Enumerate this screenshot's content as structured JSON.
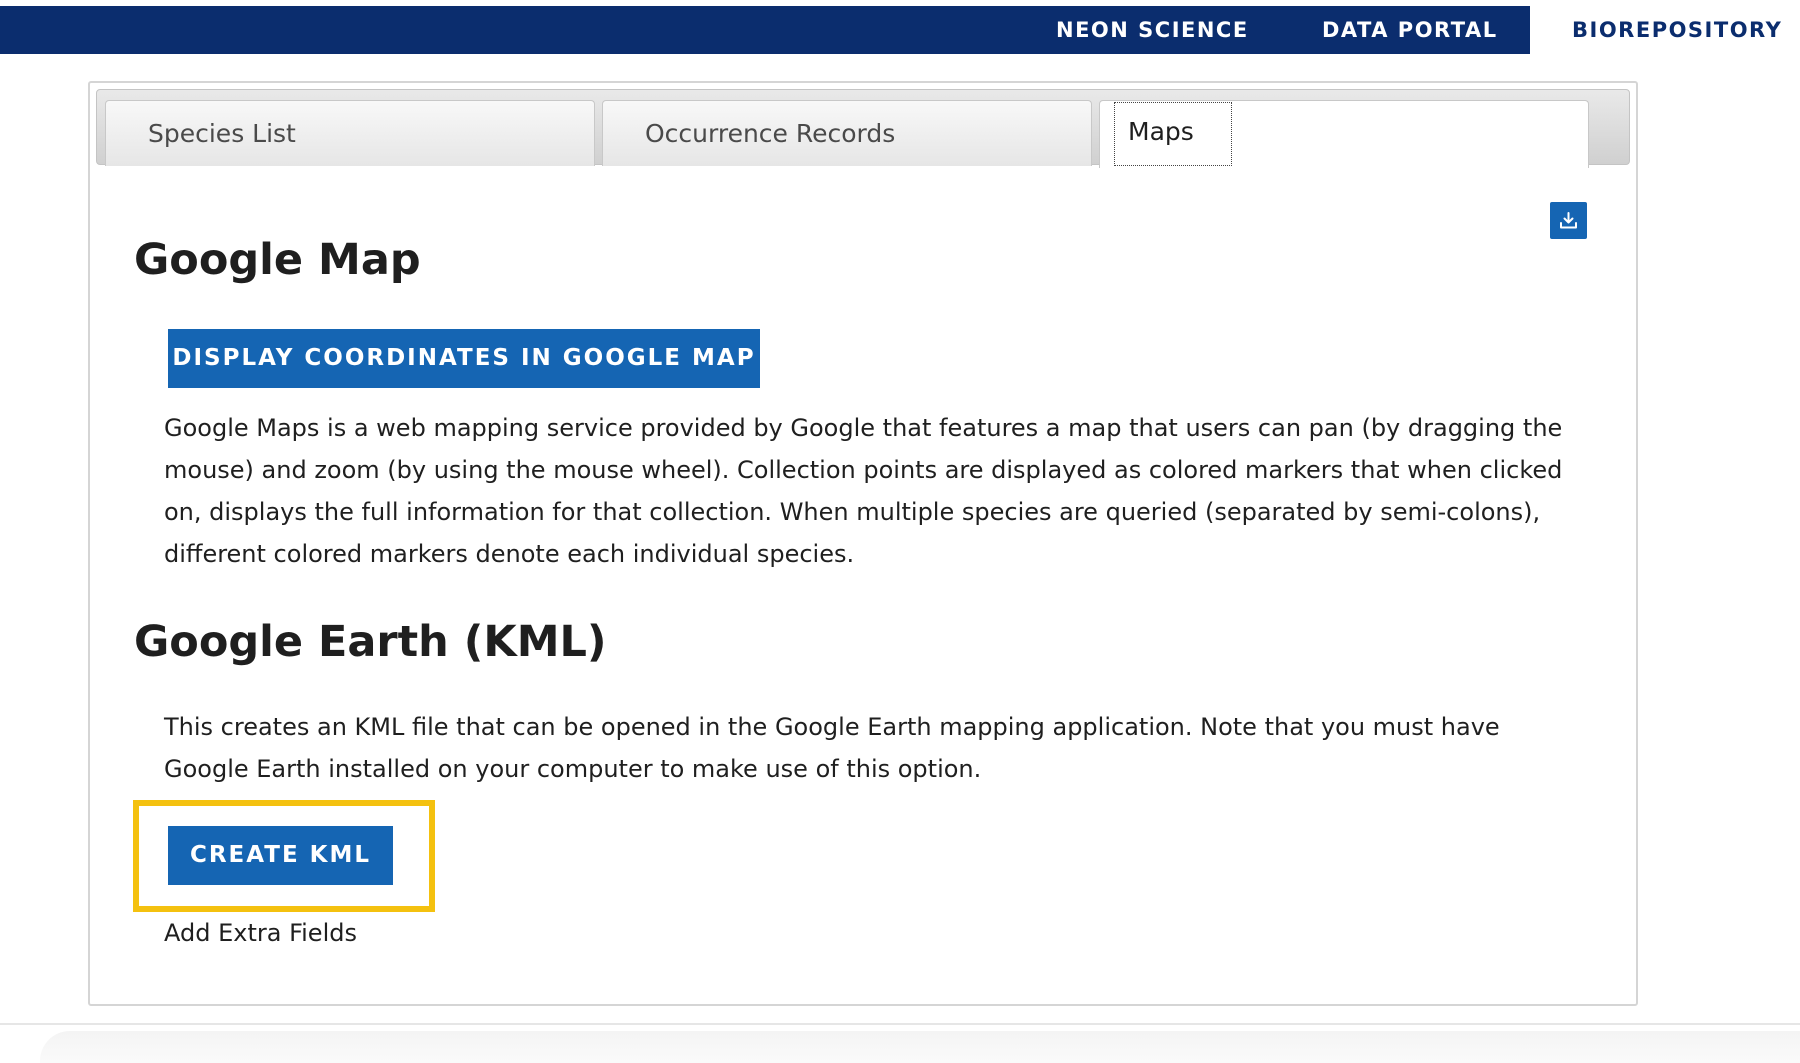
{
  "nav": {
    "items": [
      {
        "label": "NEON SCIENCE"
      },
      {
        "label": "DATA PORTAL"
      },
      {
        "label": "BIOREPOSITORY",
        "active": true
      }
    ],
    "bar_color": "#0b2d6e"
  },
  "tabs": [
    {
      "label": "Species List"
    },
    {
      "label": "Occurrence Records"
    },
    {
      "label": "Maps",
      "selected": true
    }
  ],
  "toolbar": {
    "download_icon": "download-icon"
  },
  "google_map": {
    "title": "Google Map",
    "button_label": "DISPLAY COORDINATES IN GOOGLE MAP",
    "description": "Google Maps is a web mapping service provided by Google that features a map that users can pan (by dragging the mouse) and zoom (by using the mouse wheel). Collection points are displayed as colored markers that when clicked on, displays the full information for that collection. When multiple species are queried (separated by semi-colons), different colored markers denote each individual species."
  },
  "google_earth": {
    "title": "Google Earth (KML)",
    "description": "This creates an KML file that can be opened in the Google Earth mapping application. Note that you must have Google Earth installed on your computer to make use of this option.",
    "button_label": "CREATE KML",
    "extra_fields_label": "Add Extra Fields"
  },
  "colors": {
    "primary_button": "#1565b3",
    "highlight": "#f4c10f"
  }
}
